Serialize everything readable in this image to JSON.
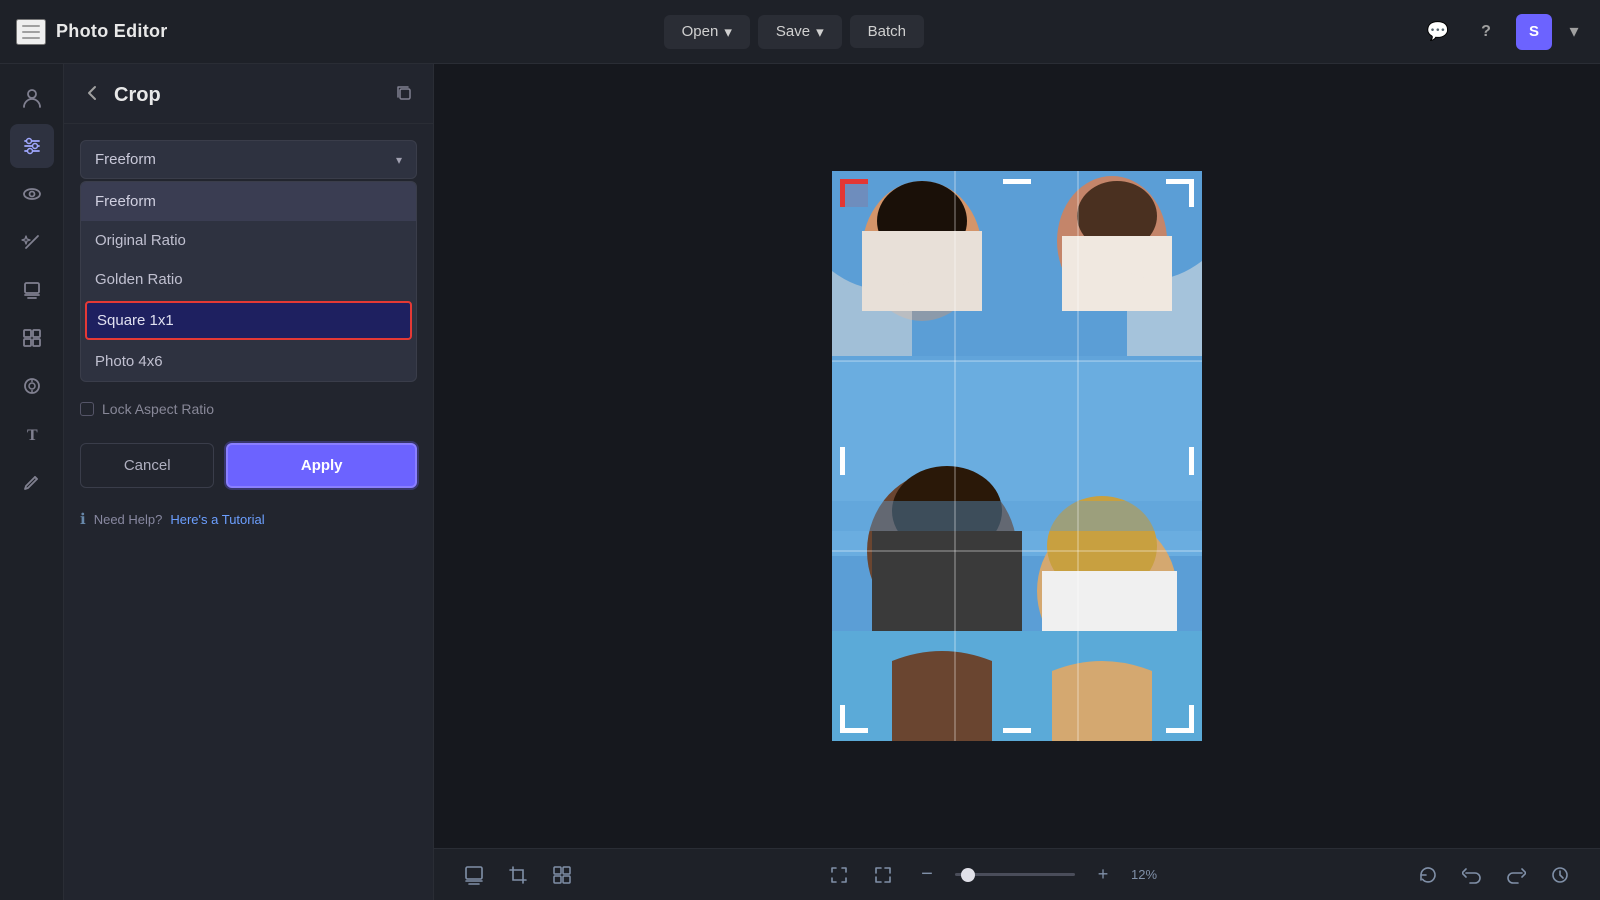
{
  "app": {
    "title": "Photo Editor",
    "hamburger_label": "menu"
  },
  "header": {
    "open_label": "Open",
    "save_label": "Save",
    "batch_label": "Batch",
    "open_chevron": "▾",
    "save_chevron": "▾"
  },
  "header_right": {
    "chat_icon": "💬",
    "help_icon": "?",
    "avatar_label": "S",
    "chevron_down": "▾"
  },
  "panel": {
    "back_icon": "←",
    "title": "Crop",
    "copy_icon": "⧉",
    "dropdown_selected": "Freeform",
    "dropdown_arrow": "▾",
    "dropdown_items": [
      {
        "label": "Freeform",
        "selected": false,
        "highlighted": true
      },
      {
        "label": "Original Ratio",
        "selected": false
      },
      {
        "label": "Golden Ratio",
        "selected": false
      },
      {
        "label": "Square 1x1",
        "selected": true
      },
      {
        "label": "Photo 4x6",
        "selected": false
      }
    ],
    "lock_ratio_label": "Lock Aspect Ratio",
    "cancel_label": "Cancel",
    "apply_label": "Apply",
    "help_prefix": "Need Help?",
    "help_link": "Here's a Tutorial",
    "info_icon": "ℹ"
  },
  "sidebar": {
    "icons": [
      {
        "name": "person-icon",
        "symbol": "👤"
      },
      {
        "name": "sliders-icon",
        "symbol": "⚙",
        "active": true
      },
      {
        "name": "eye-icon",
        "symbol": "👁"
      },
      {
        "name": "magic-icon",
        "symbol": "✦"
      },
      {
        "name": "layers-icon",
        "symbol": "◧"
      },
      {
        "name": "objects-icon",
        "symbol": "⬡"
      },
      {
        "name": "effects-icon",
        "symbol": "◈"
      },
      {
        "name": "text-icon",
        "symbol": "T"
      },
      {
        "name": "draw-icon",
        "symbol": "✎"
      }
    ]
  },
  "bottom_toolbar": {
    "left_icons": [
      {
        "name": "layers-tb-icon",
        "symbol": "◫"
      },
      {
        "name": "crop-tb-icon",
        "symbol": "⊡"
      },
      {
        "name": "grid-tb-icon",
        "symbol": "⊞"
      }
    ],
    "center_icons": [
      {
        "name": "fullscreen-icon",
        "symbol": "⛶"
      },
      {
        "name": "fit-icon",
        "symbol": "⤢"
      },
      {
        "name": "zoom-out-icon",
        "symbol": "−"
      }
    ],
    "zoom_value": "12%",
    "zoom_percent": 12,
    "right_icons": [
      {
        "name": "refresh-icon",
        "symbol": "↺"
      },
      {
        "name": "undo-icon",
        "symbol": "↩"
      },
      {
        "name": "redo-icon",
        "symbol": "↪"
      },
      {
        "name": "history-icon",
        "symbol": "⟳"
      }
    ]
  }
}
